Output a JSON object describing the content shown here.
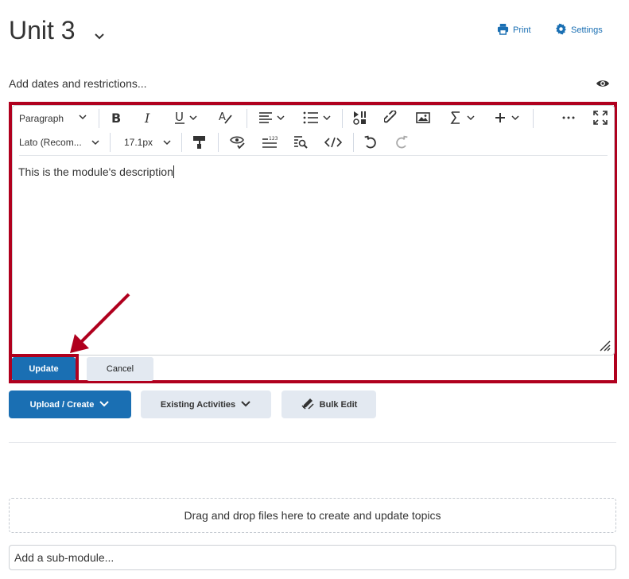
{
  "header": {
    "title": "Unit 3",
    "print_label": "Print",
    "settings_label": "Settings"
  },
  "dates_link": "Add dates and restrictions...",
  "editor": {
    "toolbar": {
      "paragraph_select": "Paragraph",
      "font_select": "Lato (Recom...",
      "size_select": "17.1px"
    },
    "content": "This is the module's description"
  },
  "actions": {
    "update_label": "Update",
    "cancel_label": "Cancel"
  },
  "buttons": {
    "upload_create": "Upload / Create",
    "existing_activities": "Existing Activities",
    "bulk_edit": "Bulk Edit"
  },
  "dropzone_text": "Drag and drop files here to create and update topics",
  "submodule_placeholder": "Add a sub-module...",
  "colors": {
    "accent": "#1a6fb3",
    "highlight": "#b0001e",
    "secondary_button": "#e3e9f1"
  }
}
